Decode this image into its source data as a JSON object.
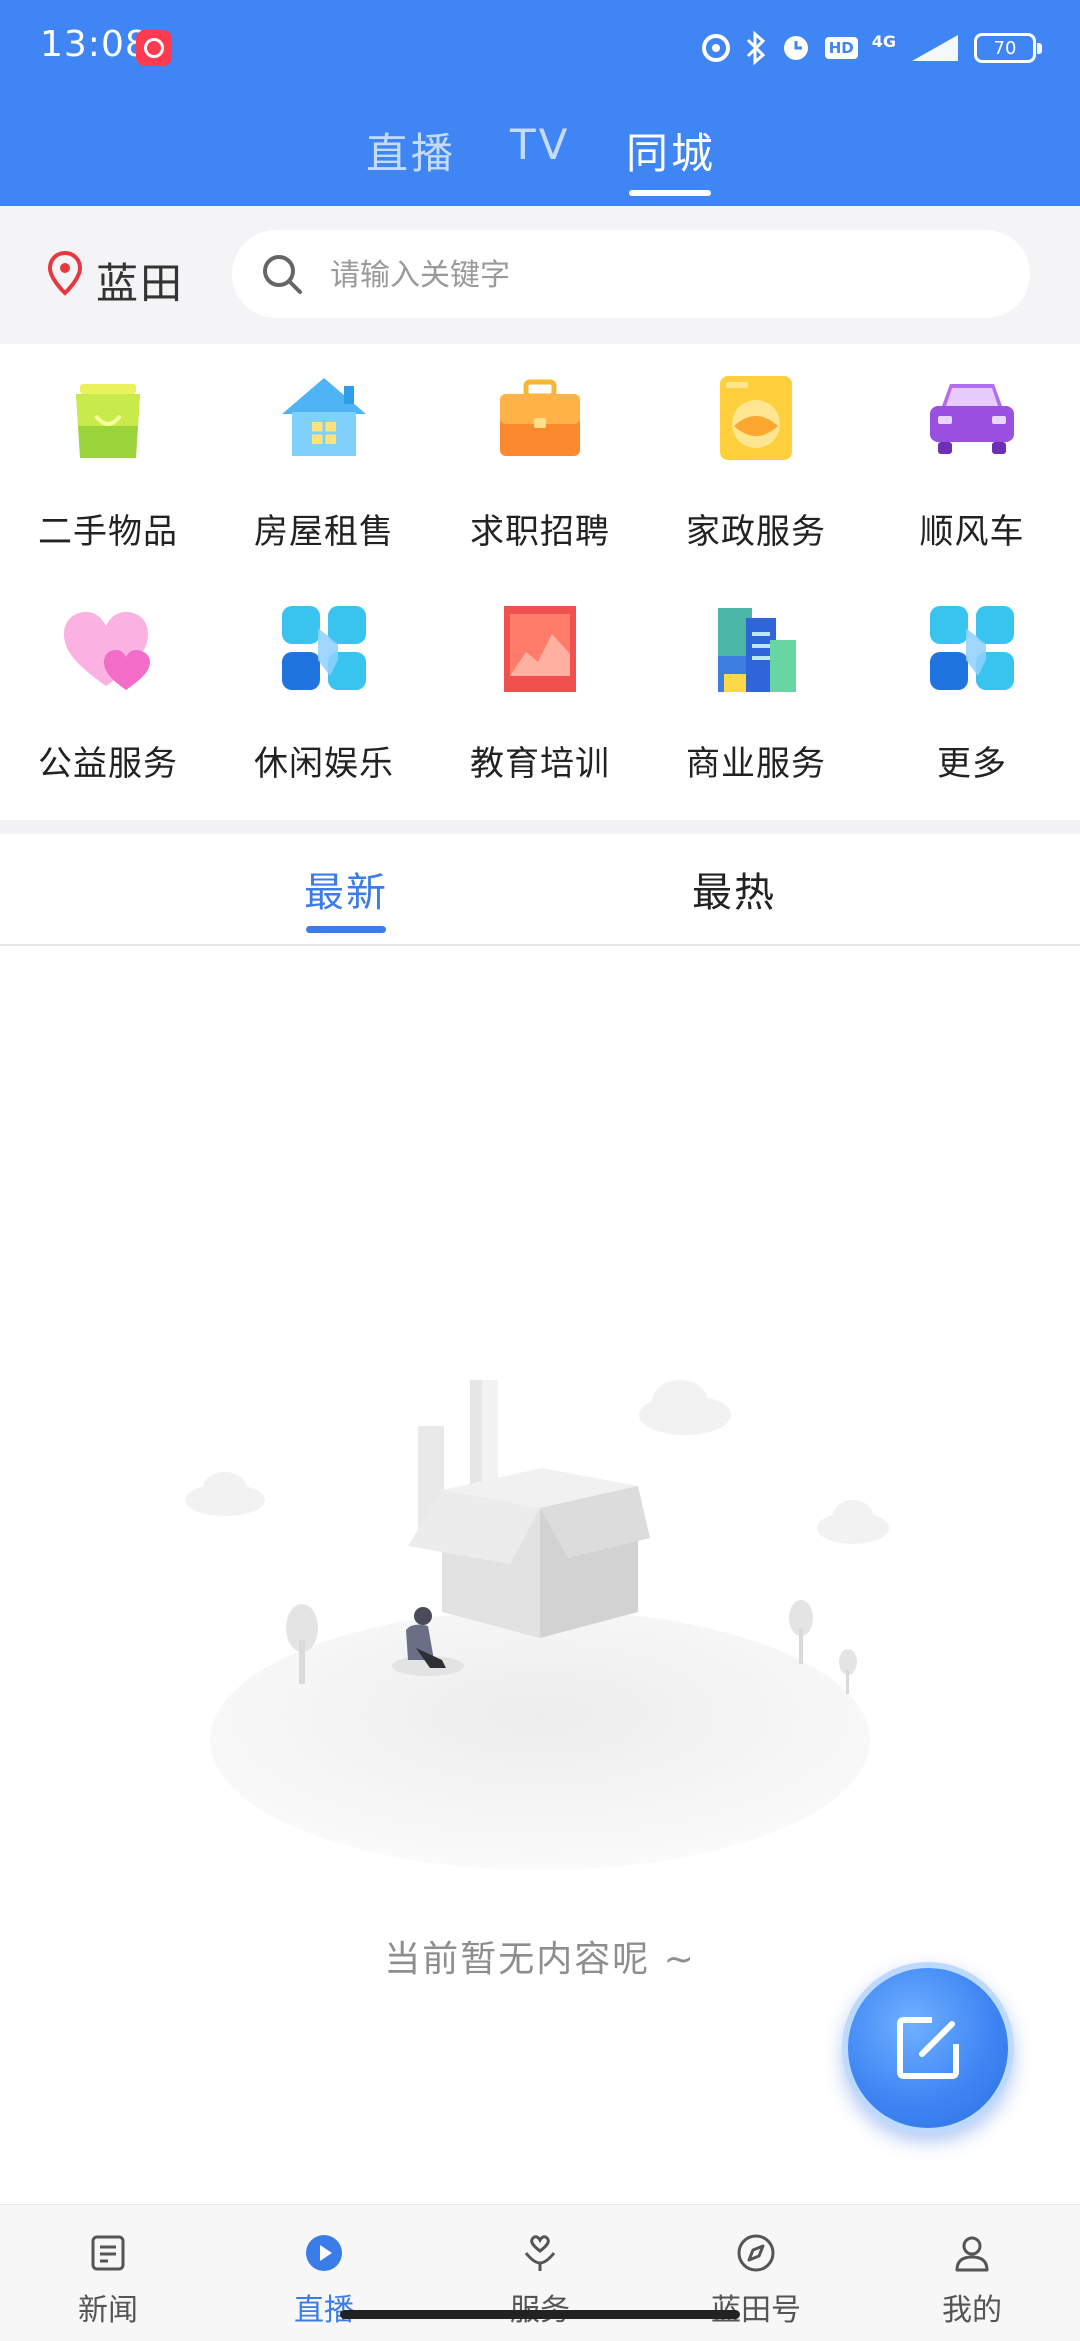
{
  "status_bar": {
    "time": "13:08",
    "hd_label": "HD",
    "network": "4G",
    "battery": "70"
  },
  "top_tabs": [
    {
      "label": "直播",
      "active": false
    },
    {
      "label": "TV",
      "active": false
    },
    {
      "label": "同城",
      "active": true
    }
  ],
  "location": {
    "label": "蓝田"
  },
  "search": {
    "placeholder": "请输入关键字",
    "value": ""
  },
  "categories": [
    {
      "label": "二手物品",
      "icon": "shopping-bag-icon"
    },
    {
      "label": "房屋租售",
      "icon": "house-icon"
    },
    {
      "label": "求职招聘",
      "icon": "briefcase-icon"
    },
    {
      "label": "家政服务",
      "icon": "washing-machine-icon"
    },
    {
      "label": "顺风车",
      "icon": "car-icon"
    },
    {
      "label": "公益服务",
      "icon": "heart-icon"
    },
    {
      "label": "休闲娱乐",
      "icon": "entertainment-icon"
    },
    {
      "label": "教育培训",
      "icon": "education-icon"
    },
    {
      "label": "商业服务",
      "icon": "buildings-icon"
    },
    {
      "label": "更多",
      "icon": "more-icon"
    }
  ],
  "feed_tabs": [
    {
      "label": "最新",
      "active": true
    },
    {
      "label": "最热",
      "active": false
    }
  ],
  "empty_state": {
    "text": "当前暂无内容呢 ~"
  },
  "fab": {
    "icon": "edit-icon"
  },
  "bottom_nav": [
    {
      "label": "新闻",
      "icon": "news-icon",
      "active": false
    },
    {
      "label": "直播",
      "icon": "play-icon",
      "active": true
    },
    {
      "label": "服务",
      "icon": "service-icon",
      "active": false
    },
    {
      "label": "蓝田号",
      "icon": "compass-icon",
      "active": false
    },
    {
      "label": "我的",
      "icon": "user-icon",
      "active": false
    }
  ],
  "colors": {
    "brand_blue": "#3f86f4",
    "active_tab": "#3b7de8",
    "location_red": "#e8383f"
  }
}
